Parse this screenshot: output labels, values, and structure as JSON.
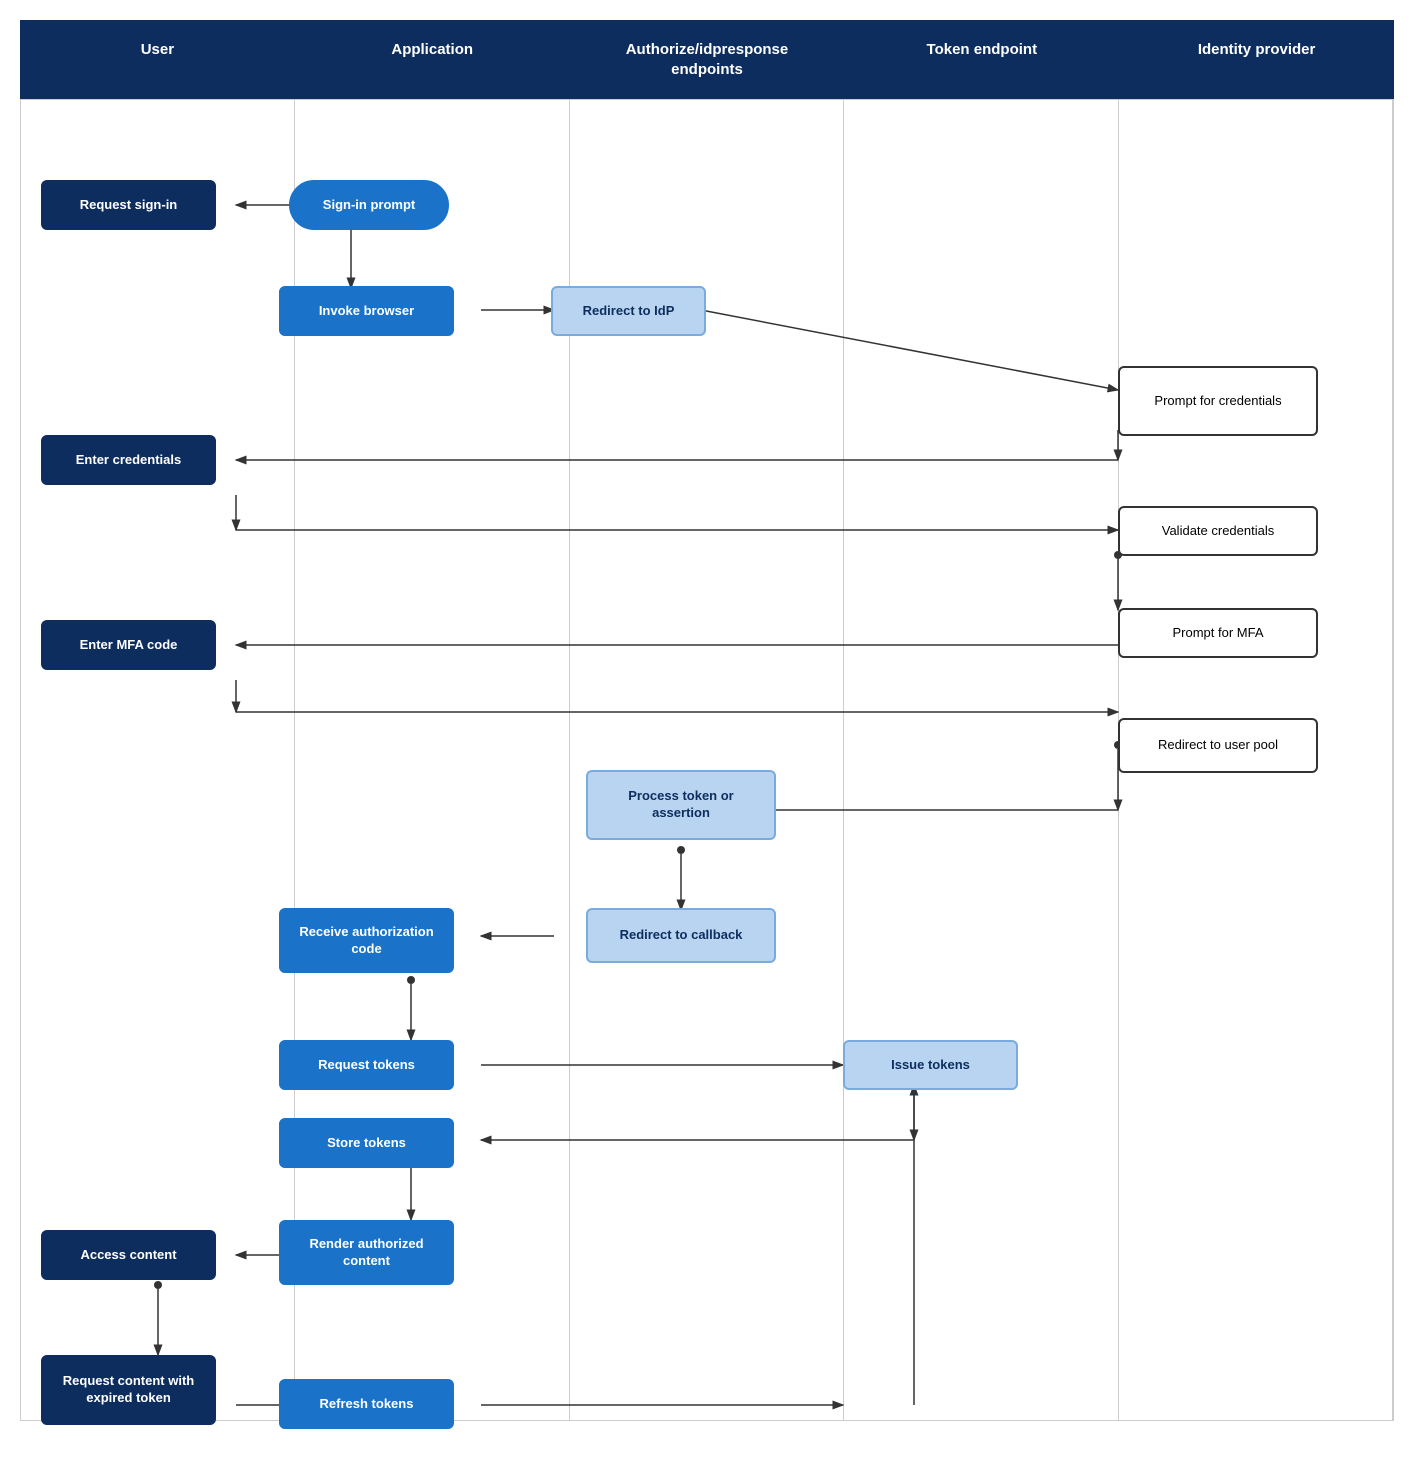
{
  "headers": [
    {
      "label": "User"
    },
    {
      "label": "Application"
    },
    {
      "label": "Authorize/idpresponse\nendpoints"
    },
    {
      "label": "Token endpoint"
    },
    {
      "label": "Identity provider"
    }
  ],
  "nodes": {
    "request_signin": "Request sign-in",
    "signin_prompt": "Sign-in prompt",
    "invoke_browser": "Invoke browser",
    "redirect_to_idp": "Redirect to IdP",
    "prompt_credentials": "Prompt for credentials",
    "enter_credentials": "Enter credentials",
    "validate_credentials": "Validate credentials",
    "prompt_mfa": "Prompt for MFA",
    "enter_mfa": "Enter MFA code",
    "redirect_user_pool": "Redirect to user pool",
    "process_token": "Process token or assertion",
    "redirect_callback": "Redirect to callback",
    "receive_auth_code": "Receive authorization code",
    "request_tokens": "Request tokens",
    "issue_tokens": "Issue tokens",
    "store_tokens": "Store tokens",
    "access_content": "Access content",
    "render_authorized": "Render authorized content",
    "request_expired": "Request content with expired token",
    "refresh_tokens": "Refresh tokens"
  }
}
